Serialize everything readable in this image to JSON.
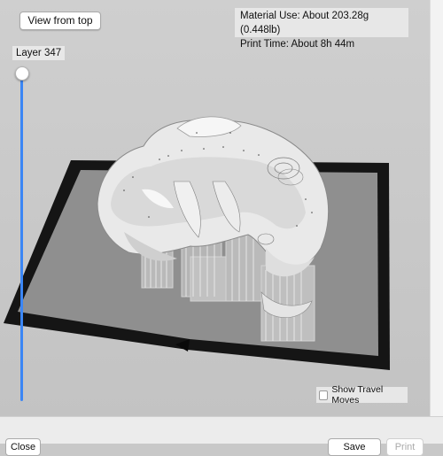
{
  "toolbar": {
    "view_from_top": "View from top"
  },
  "info": {
    "material_use": "Material Use: About 203.28g (0.448lb)",
    "print_time": "Print Time: About 8h 44m"
  },
  "layer": {
    "label": "Layer 347"
  },
  "options": {
    "show_travel_moves": "Show Travel Moves",
    "show_travel_moves_checked": false
  },
  "footer": {
    "left_button": "Close",
    "right_button_1": "Save",
    "right_button_2": "Print"
  },
  "colors": {
    "slider_accent": "#3b86f5",
    "build_plate": "#8e8e8e",
    "plate_border": "#151515",
    "model": "#ececec"
  }
}
